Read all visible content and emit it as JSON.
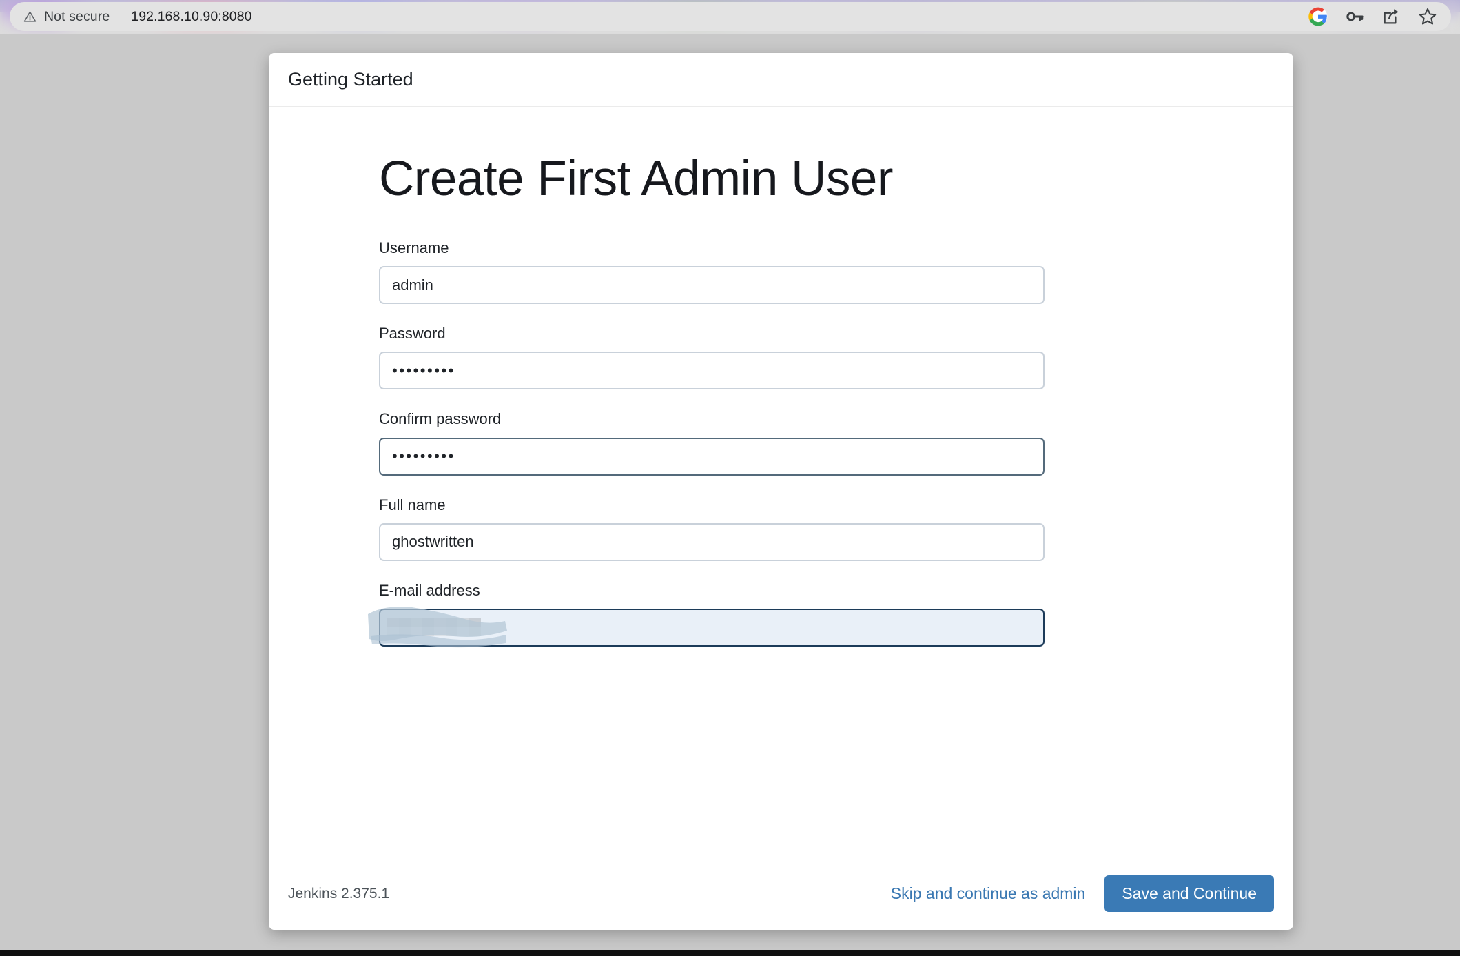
{
  "browser": {
    "security_label": "Not secure",
    "url": "192.168.10.90:8080",
    "warning_icon": "warning-triangle-icon",
    "actions": [
      {
        "name": "google-account-icon",
        "label": "G"
      },
      {
        "name": "password-key-icon",
        "label": ""
      },
      {
        "name": "share-icon",
        "label": ""
      },
      {
        "name": "bookmark-star-icon",
        "label": ""
      }
    ]
  },
  "modal": {
    "header_title": "Getting Started",
    "heading": "Create First Admin User",
    "fields": [
      {
        "key": "username",
        "label": "Username",
        "value": "admin",
        "type": "text",
        "placeholder": "",
        "state": "normal"
      },
      {
        "key": "password",
        "label": "Password",
        "value": "•••••••••",
        "type": "password",
        "placeholder": "",
        "state": "normal"
      },
      {
        "key": "confirm",
        "label": "Confirm password",
        "value": "•••••••••",
        "type": "password",
        "placeholder": "",
        "state": "active"
      },
      {
        "key": "fullname",
        "label": "Full name",
        "value": "ghostwritten",
        "type": "text",
        "placeholder": "",
        "state": "normal"
      },
      {
        "key": "email",
        "label": "E-mail address",
        "value": "",
        "type": "email",
        "placeholder": "",
        "state": "focused-redacted"
      }
    ],
    "footer": {
      "version": "Jenkins 2.375.1",
      "skip_label": "Skip and continue as admin",
      "save_label": "Save and Continue"
    }
  },
  "colors": {
    "primary_button": "#3a7ab5",
    "link": "#3a78b2",
    "page_background": "#c9c9c9",
    "modal_background": "#ffffff",
    "input_border": "#c9d1da",
    "input_border_active": "#546a7b",
    "email_border": "#1c3b59",
    "email_fill": "#e9f0f8"
  }
}
